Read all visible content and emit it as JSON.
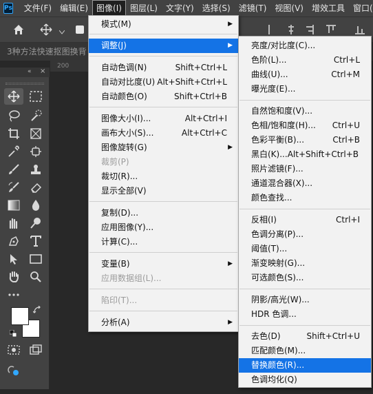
{
  "menubar": {
    "logo": "Ps",
    "items": [
      "文件(F)",
      "编辑(E)",
      "图像(I)",
      "图层(L)",
      "文字(Y)",
      "选择(S)",
      "滤镜(T)",
      "视图(V)",
      "增效工具",
      "窗口(W)"
    ]
  },
  "document": {
    "tab_title": "3种方法快速抠图换背",
    "ruler_label": "200"
  },
  "image_menu": {
    "items": [
      {
        "label": "模式(M)",
        "shortcut": "",
        "submenu": true,
        "disabled": false
      },
      {
        "label": "调整(J)",
        "shortcut": "",
        "submenu": true,
        "disabled": false
      },
      {
        "label": "自动色调(N)",
        "shortcut": "Shift+Ctrl+L",
        "submenu": false,
        "disabled": false
      },
      {
        "label": "自动对比度(U)",
        "shortcut": "Alt+Shift+Ctrl+L",
        "submenu": false,
        "disabled": false
      },
      {
        "label": "自动颜色(O)",
        "shortcut": "Shift+Ctrl+B",
        "submenu": false,
        "disabled": false
      },
      {
        "label": "图像大小(I)...",
        "shortcut": "Alt+Ctrl+I",
        "submenu": false,
        "disabled": false
      },
      {
        "label": "画布大小(S)...",
        "shortcut": "Alt+Ctrl+C",
        "submenu": false,
        "disabled": false
      },
      {
        "label": "图像旋转(G)",
        "shortcut": "",
        "submenu": true,
        "disabled": false
      },
      {
        "label": "裁剪(P)",
        "shortcut": "",
        "submenu": false,
        "disabled": true
      },
      {
        "label": "裁切(R)...",
        "shortcut": "",
        "submenu": false,
        "disabled": false
      },
      {
        "label": "显示全部(V)",
        "shortcut": "",
        "submenu": false,
        "disabled": false
      },
      {
        "label": "复制(D)...",
        "shortcut": "",
        "submenu": false,
        "disabled": false
      },
      {
        "label": "应用图像(Y)...",
        "shortcut": "",
        "submenu": false,
        "disabled": false
      },
      {
        "label": "计算(C)...",
        "shortcut": "",
        "submenu": false,
        "disabled": false
      },
      {
        "label": "变量(B)",
        "shortcut": "",
        "submenu": true,
        "disabled": false
      },
      {
        "label": "应用数据组(L)...",
        "shortcut": "",
        "submenu": false,
        "disabled": true
      },
      {
        "label": "陷印(T)...",
        "shortcut": "",
        "submenu": false,
        "disabled": true
      },
      {
        "label": "分析(A)",
        "shortcut": "",
        "submenu": true,
        "disabled": false
      }
    ]
  },
  "adjust_menu": {
    "items": [
      {
        "label": "亮度/对比度(C)...",
        "shortcut": ""
      },
      {
        "label": "色阶(L)...",
        "shortcut": "Ctrl+L"
      },
      {
        "label": "曲线(U)...",
        "shortcut": "Ctrl+M"
      },
      {
        "label": "曝光度(E)...",
        "shortcut": ""
      },
      {
        "label": "自然饱和度(V)...",
        "shortcut": ""
      },
      {
        "label": "色相/饱和度(H)...",
        "shortcut": "Ctrl+U"
      },
      {
        "label": "色彩平衡(B)...",
        "shortcut": "Ctrl+B"
      },
      {
        "label": "黑白(K)...",
        "shortcut": "Alt+Shift+Ctrl+B"
      },
      {
        "label": "照片滤镜(F)...",
        "shortcut": ""
      },
      {
        "label": "通道混合器(X)...",
        "shortcut": ""
      },
      {
        "label": "颜色查找...",
        "shortcut": ""
      },
      {
        "label": "反相(I)",
        "shortcut": "Ctrl+I"
      },
      {
        "label": "色调分离(P)...",
        "shortcut": ""
      },
      {
        "label": "阈值(T)...",
        "shortcut": ""
      },
      {
        "label": "渐变映射(G)...",
        "shortcut": ""
      },
      {
        "label": "可选颜色(S)...",
        "shortcut": ""
      },
      {
        "label": "阴影/高光(W)...",
        "shortcut": ""
      },
      {
        "label": "HDR 色调...",
        "shortcut": ""
      },
      {
        "label": "去色(D)",
        "shortcut": "Shift+Ctrl+U"
      },
      {
        "label": "匹配颜色(M)...",
        "shortcut": ""
      },
      {
        "label": "替换颜色(R)...",
        "shortcut": ""
      },
      {
        "label": "色调均化(Q)",
        "shortcut": ""
      }
    ]
  },
  "tools": {
    "icons": [
      "move-icon",
      "marquee-icon",
      "lasso-icon",
      "quick-select-icon",
      "crop-icon",
      "frame-icon",
      "eyedropper-icon",
      "spot-heal-icon",
      "brush-icon",
      "stamp-icon",
      "history-brush-icon",
      "eraser-icon",
      "gradient-icon",
      "blur-icon",
      "smudge-icon",
      "dodge-icon",
      "pen-icon",
      "type-icon",
      "path-select-icon",
      "rectangle-icon",
      "hand-icon",
      "zoom-icon",
      "more-icon"
    ]
  },
  "colors": {
    "accent": "#1473e6",
    "menubar": "#424242",
    "canvas": "#282828"
  }
}
